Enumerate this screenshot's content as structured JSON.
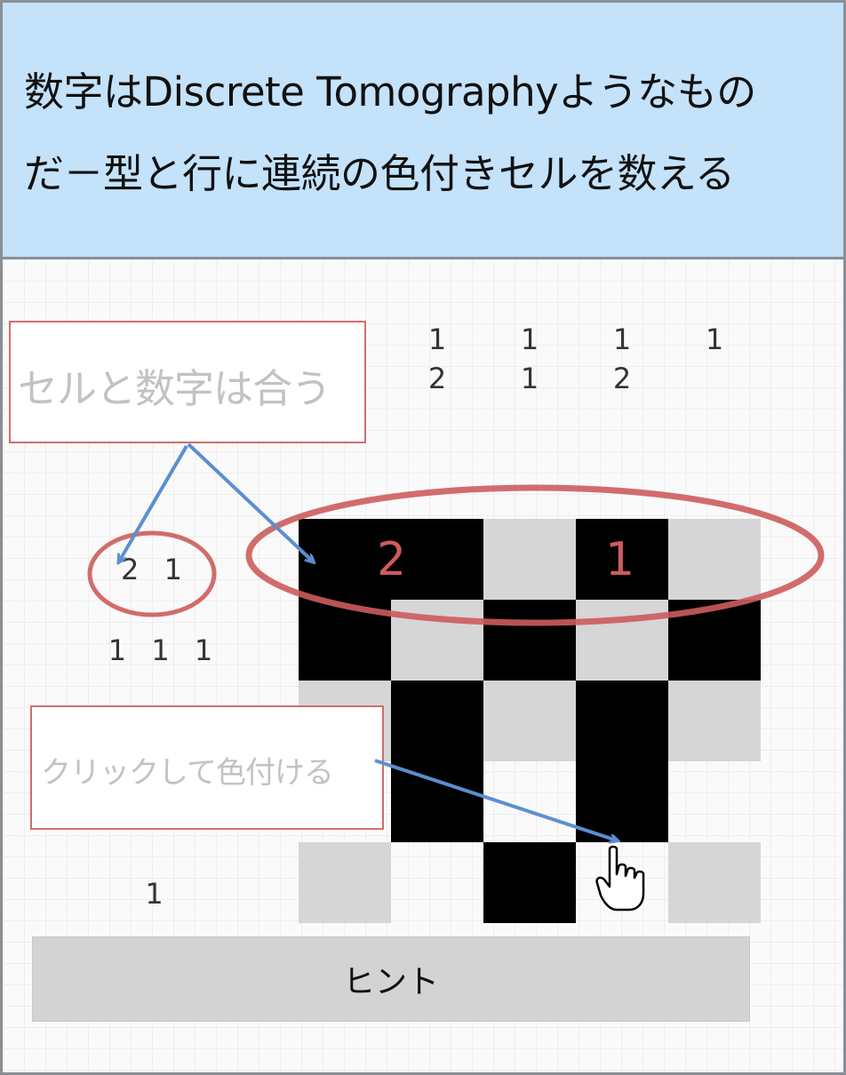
{
  "header": {
    "line1": "数字はDiscrete Tomographyようなもの",
    "line2": "だ－型と行に連続の色付きセルを数える"
  },
  "column_clues": [
    {
      "top": "1",
      "bottom": "2"
    },
    {
      "top": "1",
      "bottom": "1"
    },
    {
      "top": "1",
      "bottom": "2"
    },
    {
      "top": "1",
      "bottom": ""
    }
  ],
  "row_clues": [
    "2 1",
    "1 1 1",
    "",
    "",
    "1"
  ],
  "grid": [
    [
      "filled",
      "filled",
      "empty",
      "filled",
      "empty"
    ],
    [
      "filled",
      "empty",
      "filled",
      "empty",
      "filled"
    ],
    [
      "empty",
      "filled",
      "empty",
      "filled",
      "empty"
    ],
    [
      "blank",
      "filled",
      "blank",
      "filled",
      "blank"
    ],
    [
      "empty",
      "blank",
      "filled",
      "blank",
      "empty"
    ]
  ],
  "annotations": {
    "callout_match": "セルと数字は合う",
    "callout_click": "クリックして色付ける",
    "run_label_2": "2",
    "run_label_1": "1"
  },
  "hint_button": {
    "label": "ヒント"
  },
  "colors": {
    "header_bg": "#c4e2fa",
    "filled_cell": "#000000",
    "empty_cell": "#d6d6d6",
    "annotation_red": "#cd5c5c",
    "arrow_blue": "#5b8fcf"
  },
  "icons": [
    "hand-pointer-icon"
  ]
}
